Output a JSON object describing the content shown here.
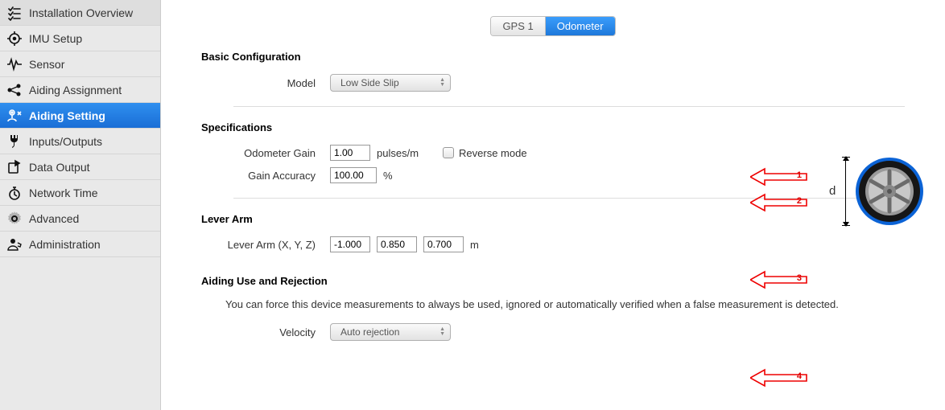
{
  "sidebar": {
    "items": [
      {
        "label": "Installation Overview",
        "icon": "checklist-icon"
      },
      {
        "label": "IMU Setup",
        "icon": "target-icon"
      },
      {
        "label": "Sensor",
        "icon": "wave-icon"
      },
      {
        "label": "Aiding Assignment",
        "icon": "nodes-icon"
      },
      {
        "label": "Aiding Setting",
        "icon": "map-pin-icon",
        "active": true
      },
      {
        "label": "Inputs/Outputs",
        "icon": "plug-icon"
      },
      {
        "label": "Data Output",
        "icon": "export-icon"
      },
      {
        "label": "Network Time",
        "icon": "stopwatch-icon"
      },
      {
        "label": "Advanced",
        "icon": "gear-icon"
      },
      {
        "label": "Administration",
        "icon": "user-icon"
      }
    ]
  },
  "tabs": [
    {
      "label": "GPS 1",
      "active": false
    },
    {
      "label": "Odometer",
      "active": true
    }
  ],
  "sections": {
    "basic": {
      "title": "Basic Configuration",
      "model_label": "Model",
      "model_value": "Low Side Slip"
    },
    "specs": {
      "title": "Specifications",
      "gain_label": "Odometer Gain",
      "gain_value": "1.00",
      "gain_unit": "pulses/m",
      "reverse_label": "Reverse mode",
      "reverse_checked": false,
      "accuracy_label": "Gain Accuracy",
      "accuracy_value": "100.00",
      "accuracy_unit": "%"
    },
    "lever": {
      "title": "Lever Arm",
      "label": "Lever Arm (X, Y, Z)",
      "x": "-1.000",
      "y": "0.850",
      "z": "0.700",
      "unit": "m"
    },
    "aiding": {
      "title": "Aiding Use and Rejection",
      "description": "You can force this device measurements to always be used, ignored or automatically verified when a false measurement is detected.",
      "velocity_label": "Velocity",
      "velocity_value": "Auto rejection"
    }
  },
  "annotations": {
    "arrows": [
      "1",
      "2",
      "3",
      "4"
    ],
    "diameter_label": "d"
  }
}
